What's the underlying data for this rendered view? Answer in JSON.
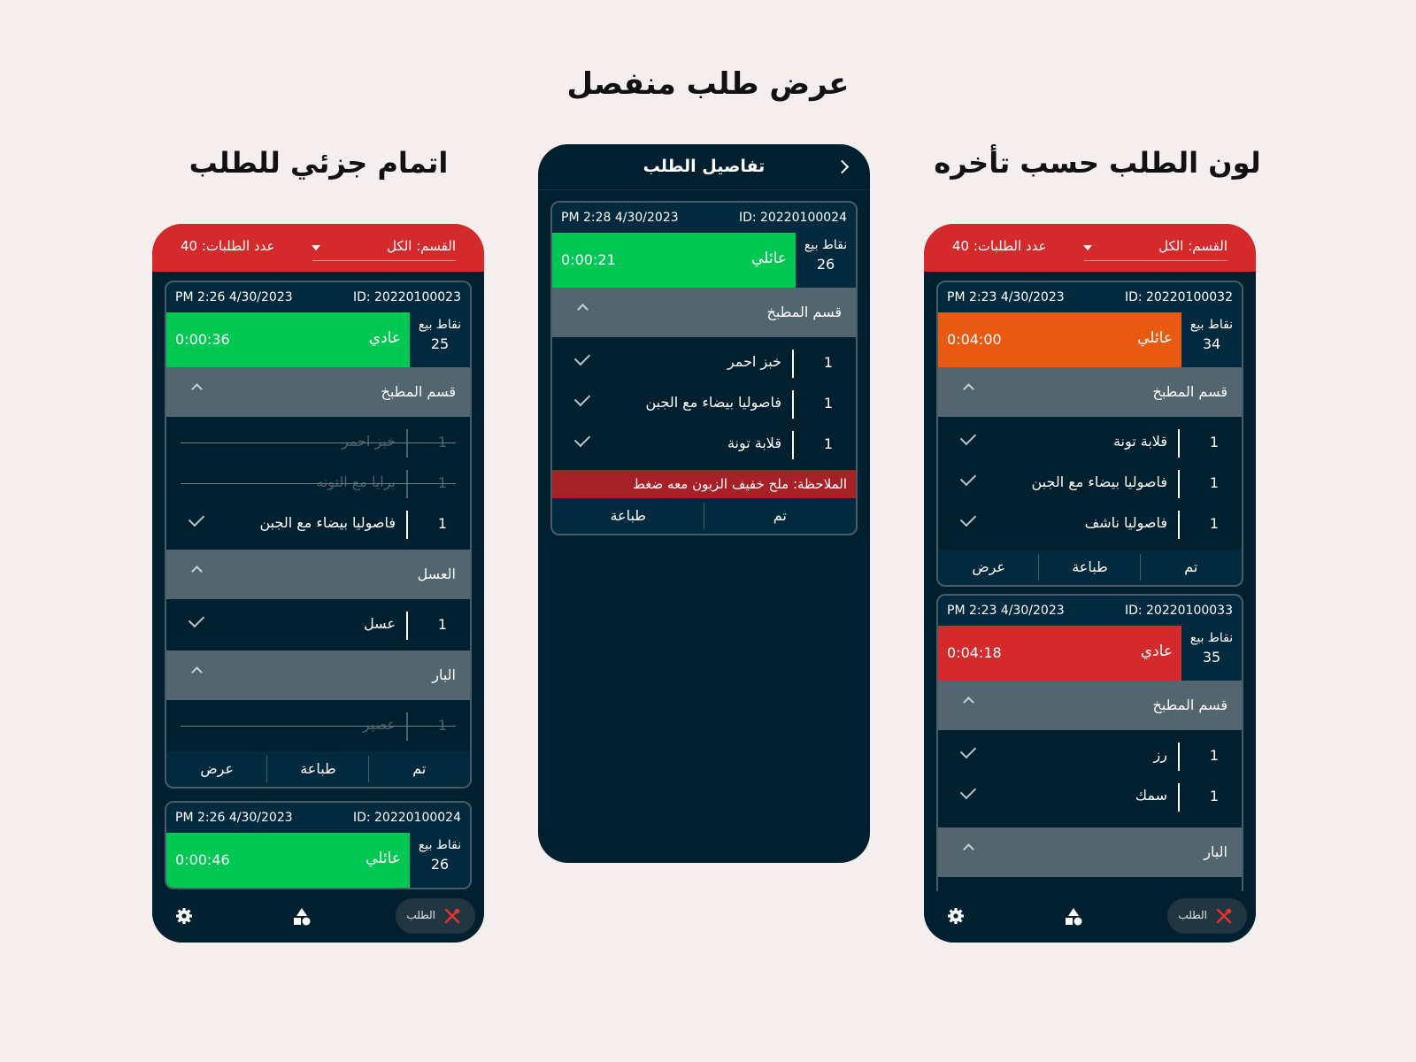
{
  "titles": {
    "main": "عرض طلب منفصل",
    "left": "اتمام جزئي للطلب",
    "right": "لون الطلب حسب تأخره"
  },
  "topbar": {
    "department": "القسم: الكل",
    "count": "عدد الطلبات: 40"
  },
  "labels": {
    "pos": "نقاط بيع",
    "done": "تم",
    "print": "طباعة",
    "view": "عرض",
    "nav_order": "الطلب"
  },
  "left": {
    "card1": {
      "id": "ID: 20220100023",
      "date": "PM 2:26 4/30/2023",
      "timer": "0:00:36",
      "type": "عادي",
      "pos": "25",
      "status_color": "#00c853",
      "sections": [
        {
          "name": "قسم المطبخ",
          "items": [
            {
              "qty": "1",
              "name": "خبز احمر",
              "done": true
            },
            {
              "qty": "1",
              "name": "برايا مع التونه",
              "done": true
            },
            {
              "qty": "1",
              "name": "فاصوليا بيضاء مع الجبن",
              "done": false
            }
          ]
        },
        {
          "name": "العسل",
          "items": [
            {
              "qty": "1",
              "name": "عسل",
              "done": false
            }
          ]
        },
        {
          "name": "البار",
          "items": [
            {
              "qty": "1",
              "name": "عصير",
              "done": true
            }
          ]
        }
      ]
    },
    "card2": {
      "id": "ID: 20220100024",
      "date": "PM 2:26 4/30/2023",
      "timer": "0:00:46",
      "type": "عائلي",
      "pos": "26",
      "status_color": "#00c853"
    }
  },
  "middle": {
    "header": "تفاصيل الطلب",
    "card": {
      "id": "ID: 20220100024",
      "date": "PM 2:28 4/30/2023",
      "timer": "0:00:21",
      "type": "عائلي",
      "pos": "26",
      "status_color": "#00c853",
      "section": "قسم المطبخ",
      "items": [
        {
          "qty": "1",
          "name": "خبز احمر"
        },
        {
          "qty": "1",
          "name": "فاصوليا بيضاء مع الجبن"
        },
        {
          "qty": "1",
          "name": "قلابة تونة"
        }
      ],
      "note": "الملاحظة: ملح خفيف الزبون معه ضغط"
    }
  },
  "right": {
    "card1": {
      "id": "ID: 20220100032",
      "date": "PM 2:23 4/30/2023",
      "timer": "0:04:00",
      "type": "عائلي",
      "pos": "34",
      "status_color": "#e85a12",
      "section": "قسم المطبخ",
      "items": [
        {
          "qty": "1",
          "name": "قلابة تونة"
        },
        {
          "qty": "1",
          "name": "فاصوليا بيضاء مع الجبن"
        },
        {
          "qty": "1",
          "name": "فاصوليا ناشف"
        }
      ]
    },
    "card2": {
      "id": "ID: 20220100033",
      "date": "PM 2:23 4/30/2023",
      "timer": "0:04:18",
      "type": "عادي",
      "pos": "35",
      "status_color": "#d42a2b",
      "section": "قسم المطبخ",
      "items": [
        {
          "qty": "1",
          "name": "رز"
        },
        {
          "qty": "1",
          "name": "سمك"
        }
      ],
      "section2": "البار"
    }
  },
  "icons": {
    "settings": "gear-icon",
    "categories": "shapes-icon",
    "order": "utensils-icon"
  }
}
